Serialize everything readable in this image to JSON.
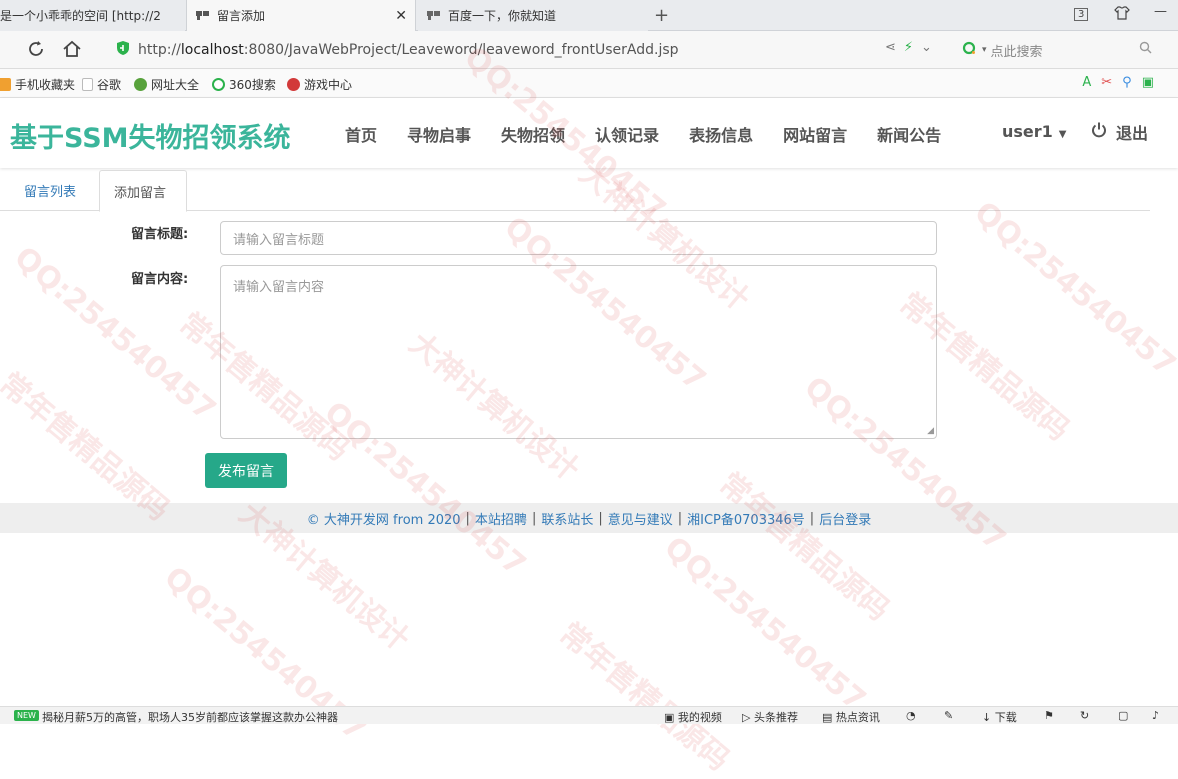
{
  "browser": {
    "tabs": [
      {
        "title": "是一个小乖乖的空间 [http://2",
        "active": false
      },
      {
        "title": "留言添加",
        "active": true
      },
      {
        "title": "百度一下，你就知道",
        "active": false
      }
    ],
    "tab_count": "3",
    "url_prefix": "http://",
    "url_host": "localhost",
    "url_rest": ":8080/JavaWebProject/Leaveword/leaveword_frontUserAdd.jsp",
    "search_placeholder": "点此搜索",
    "bookmarks": [
      {
        "label": "手机收藏夹",
        "color": "#f0a030"
      },
      {
        "label": "谷歌",
        "color": "#cccccc"
      },
      {
        "label": "网址大全",
        "color": "#58a23c"
      },
      {
        "label": "360搜索",
        "color": "#2bb24c"
      },
      {
        "label": "游戏中心",
        "color": "#d23a3a"
      }
    ]
  },
  "site": {
    "brand": "基于SSM失物招领系统",
    "brand_color": "#3bb59b",
    "nav": [
      "首页",
      "寻物启事",
      "失物招领",
      "认领记录",
      "表扬信息",
      "网站留言",
      "新闻公告"
    ],
    "user": "user1",
    "logout": "退出"
  },
  "subtabs": {
    "list": "留言列表",
    "add": "添加留言"
  },
  "form": {
    "title_label": "留言标题:",
    "title_placeholder": "请输入留言标题",
    "content_label": "留言内容:",
    "content_placeholder": "请输入留言内容",
    "submit": "发布留言",
    "accent": "#26a889"
  },
  "footer": {
    "items": [
      "© 大神开发网 from 2020",
      "本站招聘",
      "联系站长",
      "意见与建议",
      "湘ICP备0703346号",
      "后台登录"
    ],
    "separator": "|"
  },
  "watermark": {
    "texts": [
      "QQ:254540457",
      "大神计算机设计",
      "常年售精品源码"
    ]
  },
  "statusbar": {
    "badge": "NEW",
    "news": "揭秘月薪5万的高管，职场人35岁前都应该掌握这款办公神器",
    "items": [
      "我的视频",
      "头条推荐",
      "热点资讯",
      "下载"
    ]
  }
}
